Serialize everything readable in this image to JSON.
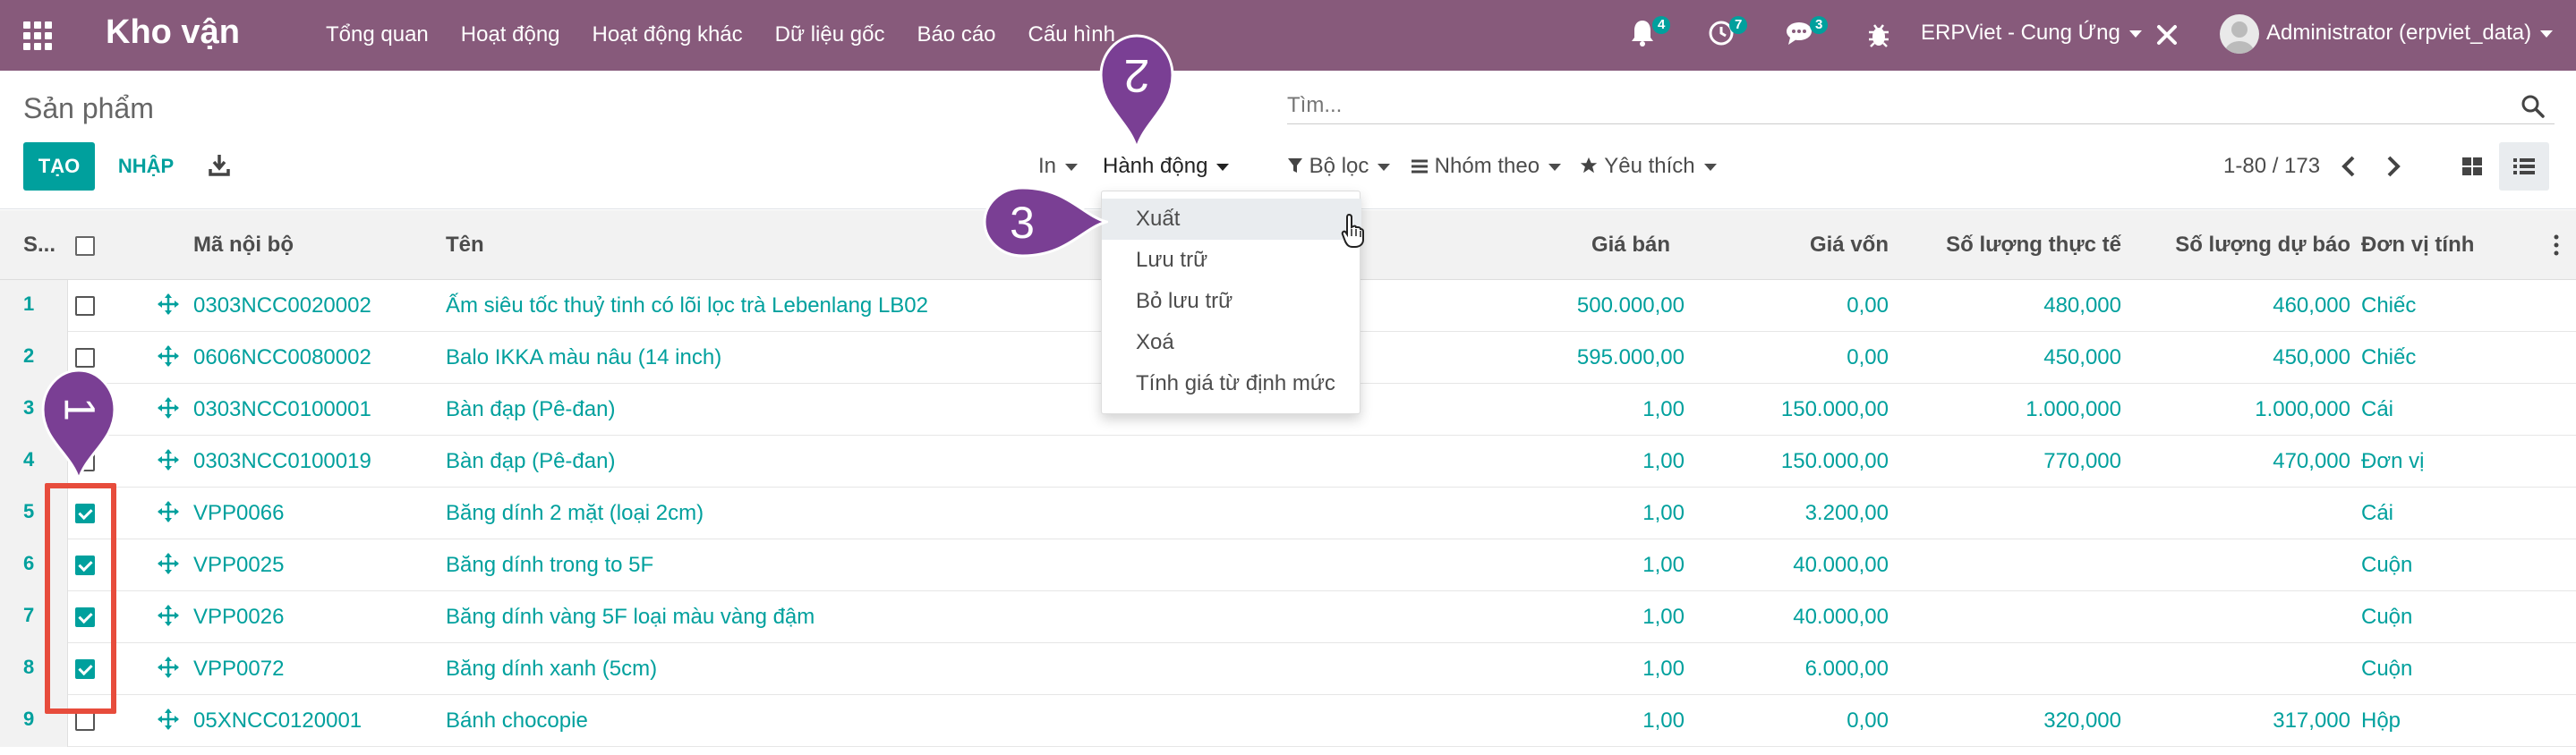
{
  "navbar": {
    "app_title": "Kho vận",
    "menu": [
      "Tổng quan",
      "Hoạt động",
      "Hoạt động khác",
      "Dữ liệu gốc",
      "Báo cáo",
      "Cấu hình"
    ],
    "notif_count": "4",
    "activity_count": "7",
    "chat_count": "3",
    "company": "ERPViet - Cung Ứng",
    "user": "Administrator (erpviet_data)"
  },
  "control_panel": {
    "breadcrumb": "Sản phẩm",
    "search_placeholder": "Tìm...",
    "create_label": "TẠO",
    "import_label": "NHẬP",
    "print_label": "In",
    "action_label": "Hành động",
    "filter_label": "Bộ lọc",
    "groupby_label": "Nhóm theo",
    "favorites_label": "Yêu thích",
    "pager": "1-80 / 173"
  },
  "action_menu": {
    "items": [
      "Xuất",
      "Lưu trữ",
      "Bỏ lưu trữ",
      "Xoá",
      "Tính giá từ định mức"
    ],
    "highlighted": "Xuất"
  },
  "table": {
    "headers": {
      "seq": "S...",
      "code": "Mã nội bộ",
      "name": "Tên",
      "sale_price": "Giá bán",
      "cost": "Giá vốn",
      "qty_onhand": "Số lượng thực tế",
      "qty_forecast": "Số lượng dự báo",
      "uom": "Đơn vị tính"
    },
    "rows": [
      {
        "seq": "1",
        "checked": false,
        "code": "0303NCC0020002",
        "name": "Ấm siêu tốc thuỷ tinh có lõi lọc trà Lebenlang LB02",
        "sale_price": "500.000,00",
        "cost": "0,00",
        "qty_onhand": "480,000",
        "qty_forecast": "460,000",
        "uom": "Chiếc"
      },
      {
        "seq": "2",
        "checked": false,
        "code": "0606NCC0080002",
        "name": "Balo IKKA màu nâu (14 inch)",
        "sale_price": "595.000,00",
        "cost": "0,00",
        "qty_onhand": "450,000",
        "qty_forecast": "450,000",
        "uom": "Chiếc"
      },
      {
        "seq": "3",
        "checked": false,
        "code": "0303NCC0100001",
        "name": "Bàn đạp (Pê-đan)",
        "sale_price": "1,00",
        "cost": "150.000,00",
        "qty_onhand": "1.000,000",
        "qty_forecast": "1.000,000",
        "uom": "Cái"
      },
      {
        "seq": "4",
        "checked": false,
        "code": "0303NCC0100019",
        "name": "Bàn đạp (Pê-đan)",
        "sale_price": "1,00",
        "cost": "150.000,00",
        "qty_onhand": "770,000",
        "qty_forecast": "470,000",
        "uom": "Đơn vị"
      },
      {
        "seq": "5",
        "checked": true,
        "code": "VPP0066",
        "name": "Băng dính 2 mặt (loại 2cm)",
        "sale_price": "1,00",
        "cost": "3.200,00",
        "qty_onhand": "",
        "qty_forecast": "",
        "uom": "Cái"
      },
      {
        "seq": "6",
        "checked": true,
        "code": "VPP0025",
        "name": "Băng dính trong to 5F",
        "sale_price": "1,00",
        "cost": "40.000,00",
        "qty_onhand": "",
        "qty_forecast": "",
        "uom": "Cuộn"
      },
      {
        "seq": "7",
        "checked": true,
        "code": "VPP0026",
        "name": "Băng dính vàng 5F loại màu vàng đậm",
        "sale_price": "1,00",
        "cost": "40.000,00",
        "qty_onhand": "",
        "qty_forecast": "",
        "uom": "Cuộn"
      },
      {
        "seq": "8",
        "checked": true,
        "code": "VPP0072",
        "name": "Băng dính xanh (5cm)",
        "sale_price": "1,00",
        "cost": "6.000,00",
        "qty_onhand": "",
        "qty_forecast": "",
        "uom": "Cuộn"
      },
      {
        "seq": "9",
        "checked": false,
        "code": "05XNCC0120001",
        "name": "Bánh chocopie",
        "sale_price": "1,00",
        "cost": "0,00",
        "qty_onhand": "320,000",
        "qty_forecast": "317,000",
        "uom": "Hộp"
      }
    ]
  },
  "annotations": {
    "marker1": "1",
    "marker2": "2",
    "marker3": "3"
  },
  "colors": {
    "navbar": "#875a7b",
    "accent": "#00a09d",
    "marker": "#7a3f94",
    "highlight_box": "#e74c3c"
  }
}
